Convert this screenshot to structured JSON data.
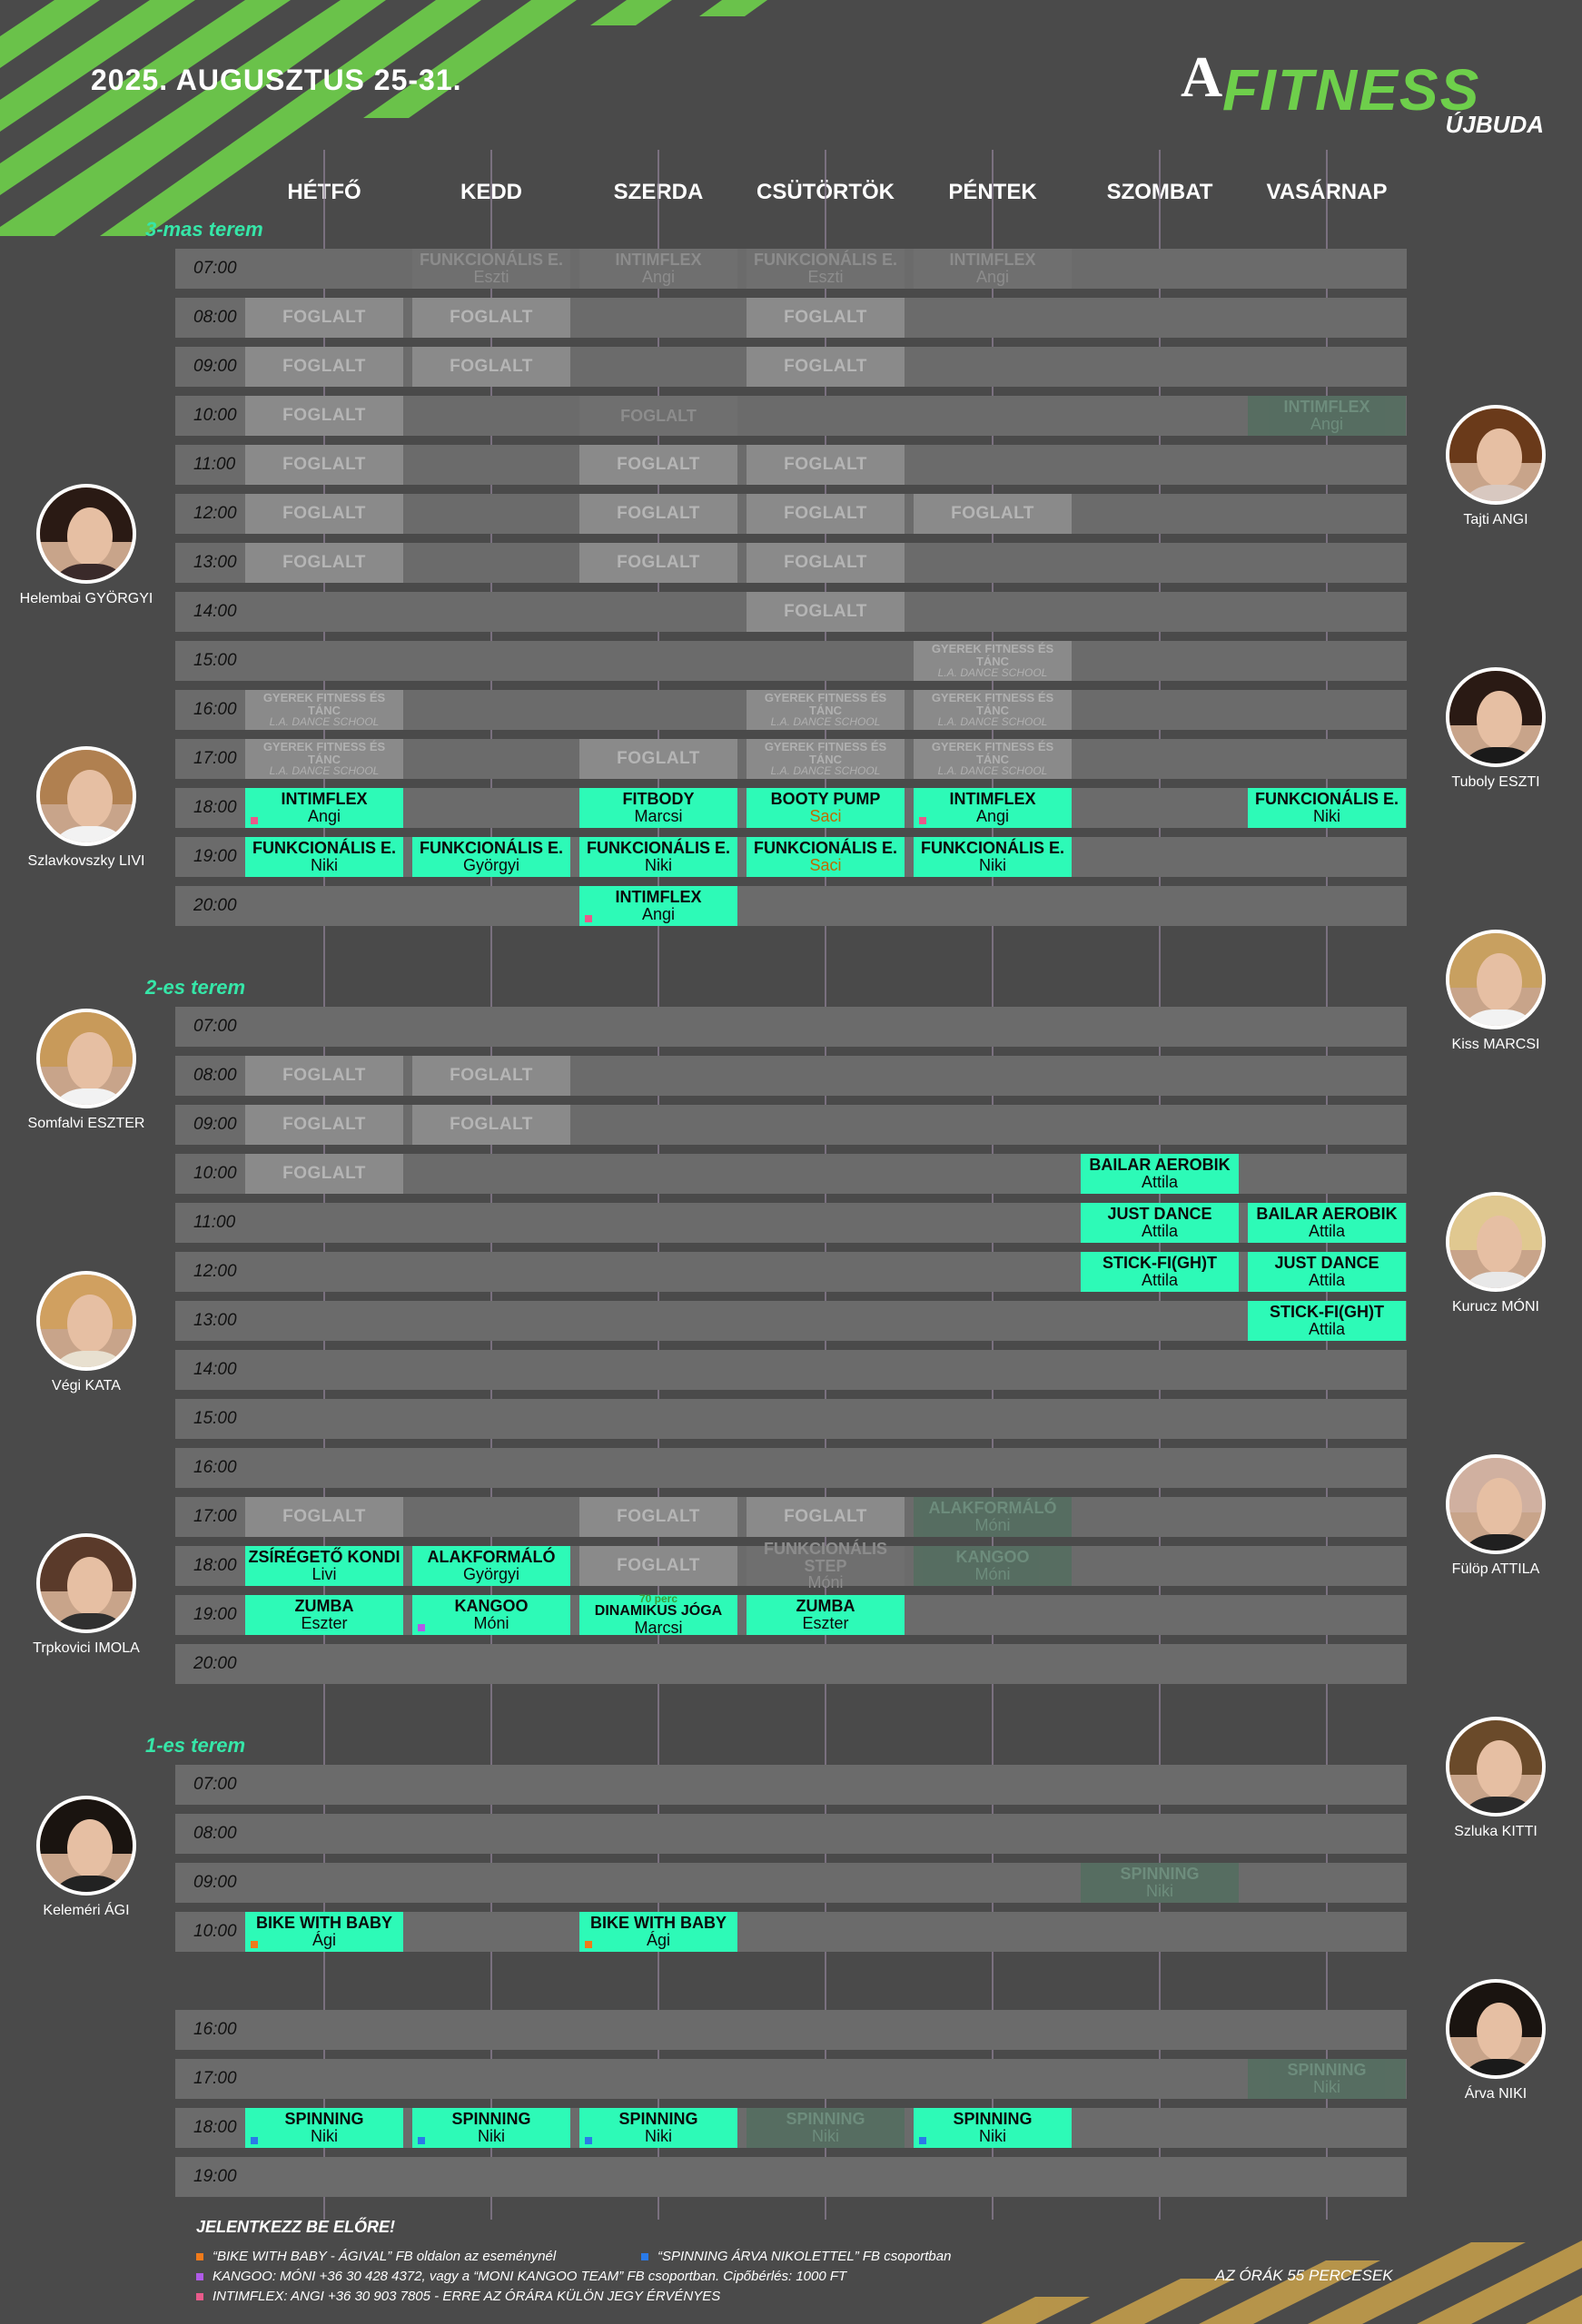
{
  "title": "2025. AUGUSZTUS 25-31.",
  "logo": {
    "mark": "A",
    "brand": "FITNESS",
    "location": "ÚJBUDA"
  },
  "days": [
    "HÉTFŐ",
    "KEDD",
    "SZERDA",
    "CSÜTÖRTÖK",
    "PÉNTEK",
    "SZOMBAT",
    "VASÁRNAP"
  ],
  "colors": {
    "active": "#2dfab7",
    "room_label": "#36e6a8",
    "stripe": "#6ecf4b",
    "background": "#4a4a4a"
  },
  "rooms": [
    {
      "label": "3-mas terem",
      "times": [
        "07:00",
        "08:00",
        "09:00",
        "10:00",
        "11:00",
        "12:00",
        "13:00",
        "14:00",
        "15:00",
        "16:00",
        "17:00",
        "18:00",
        "19:00",
        "20:00"
      ]
    },
    {
      "label": "2-es terem",
      "times": [
        "07:00",
        "08:00",
        "09:00",
        "10:00",
        "11:00",
        "12:00",
        "13:00",
        "14:00",
        "15:00",
        "16:00",
        "17:00",
        "18:00",
        "19:00",
        "20:00"
      ]
    },
    {
      "label": "1-es terem",
      "times": [
        "07:00",
        "08:00",
        "09:00",
        "10:00",
        "16:00",
        "17:00",
        "18:00",
        "19:00"
      ]
    }
  ],
  "classes": [
    {
      "room": 0,
      "slot": 0,
      "day": 1,
      "type": "faded",
      "title": "FUNKCIONÁLIS E.",
      "sub": "Eszti"
    },
    {
      "room": 0,
      "slot": 0,
      "day": 2,
      "type": "faded",
      "title": "INTIMFLEX",
      "sub": "Angi"
    },
    {
      "room": 0,
      "slot": 0,
      "day": 3,
      "type": "faded",
      "title": "FUNKCIONÁLIS E.",
      "sub": "Eszti"
    },
    {
      "room": 0,
      "slot": 0,
      "day": 4,
      "type": "faded",
      "title": "INTIMFLEX",
      "sub": "Angi"
    },
    {
      "room": 0,
      "slot": 1,
      "day": 0,
      "type": "busy",
      "title": "FOGLALT",
      "sub": ""
    },
    {
      "room": 0,
      "slot": 1,
      "day": 1,
      "type": "busy",
      "title": "FOGLALT",
      "sub": ""
    },
    {
      "room": 0,
      "slot": 1,
      "day": 3,
      "type": "busy",
      "title": "FOGLALT",
      "sub": ""
    },
    {
      "room": 0,
      "slot": 2,
      "day": 0,
      "type": "busy",
      "title": "FOGLALT",
      "sub": ""
    },
    {
      "room": 0,
      "slot": 2,
      "day": 1,
      "type": "busy",
      "title": "FOGLALT",
      "sub": ""
    },
    {
      "room": 0,
      "slot": 2,
      "day": 3,
      "type": "busy",
      "title": "FOGLALT",
      "sub": ""
    },
    {
      "room": 0,
      "slot": 3,
      "day": 0,
      "type": "busy",
      "title": "FOGLALT",
      "sub": ""
    },
    {
      "room": 0,
      "slot": 3,
      "day": 2,
      "type": "faded",
      "title": "FOGLALT",
      "sub": ""
    },
    {
      "room": 0,
      "slot": 3,
      "day": 6,
      "type": "ghost",
      "title": "INTIMFLEX",
      "sub": "Angi"
    },
    {
      "room": 0,
      "slot": 4,
      "day": 0,
      "type": "busy",
      "title": "FOGLALT",
      "sub": ""
    },
    {
      "room": 0,
      "slot": 4,
      "day": 2,
      "type": "busy",
      "title": "FOGLALT",
      "sub": ""
    },
    {
      "room": 0,
      "slot": 4,
      "day": 3,
      "type": "busy",
      "title": "FOGLALT",
      "sub": ""
    },
    {
      "room": 0,
      "slot": 5,
      "day": 0,
      "type": "busy",
      "title": "FOGLALT",
      "sub": ""
    },
    {
      "room": 0,
      "slot": 5,
      "day": 2,
      "type": "busy",
      "title": "FOGLALT",
      "sub": ""
    },
    {
      "room": 0,
      "slot": 5,
      "day": 3,
      "type": "busy",
      "title": "FOGLALT",
      "sub": ""
    },
    {
      "room": 0,
      "slot": 5,
      "day": 4,
      "type": "busy",
      "title": "FOGLALT",
      "sub": ""
    },
    {
      "room": 0,
      "slot": 6,
      "day": 0,
      "type": "busy",
      "title": "FOGLALT",
      "sub": ""
    },
    {
      "room": 0,
      "slot": 6,
      "day": 2,
      "type": "busy",
      "title": "FOGLALT",
      "sub": ""
    },
    {
      "room": 0,
      "slot": 6,
      "day": 3,
      "type": "busy",
      "title": "FOGLALT",
      "sub": ""
    },
    {
      "room": 0,
      "slot": 7,
      "day": 3,
      "type": "busy",
      "title": "FOGLALT",
      "sub": ""
    },
    {
      "room": 0,
      "slot": 8,
      "day": 4,
      "type": "kid",
      "title": "GYEREK FITNESS ÉS TÁNC",
      "sub": "L.A. DANCE SCHOOL"
    },
    {
      "room": 0,
      "slot": 9,
      "day": 0,
      "type": "kid",
      "title": "GYEREK FITNESS ÉS TÁNC",
      "sub": "L.A. DANCE SCHOOL"
    },
    {
      "room": 0,
      "slot": 9,
      "day": 3,
      "type": "kid",
      "title": "GYEREK FITNESS ÉS TÁNC",
      "sub": "L.A. DANCE SCHOOL"
    },
    {
      "room": 0,
      "slot": 9,
      "day": 4,
      "type": "kid",
      "title": "GYEREK FITNESS ÉS TÁNC",
      "sub": "L.A. DANCE SCHOOL"
    },
    {
      "room": 0,
      "slot": 10,
      "day": 0,
      "type": "kid",
      "title": "GYEREK FITNESS ÉS TÁNC",
      "sub": "L.A. DANCE SCHOOL"
    },
    {
      "room": 0,
      "slot": 10,
      "day": 2,
      "type": "busy",
      "title": "FOGLALT",
      "sub": ""
    },
    {
      "room": 0,
      "slot": 10,
      "day": 3,
      "type": "kid",
      "title": "GYEREK FITNESS ÉS TÁNC",
      "sub": "L.A. DANCE SCHOOL"
    },
    {
      "room": 0,
      "slot": 10,
      "day": 4,
      "type": "kid",
      "title": "GYEREK FITNESS ÉS TÁNC",
      "sub": "L.A. DANCE SCHOOL"
    },
    {
      "room": 0,
      "slot": 11,
      "day": 0,
      "type": "active",
      "title": "INTIMFLEX",
      "sub": "Angi",
      "dot": "#e85a8a"
    },
    {
      "room": 0,
      "slot": 11,
      "day": 2,
      "type": "active",
      "title": "FITBODY",
      "sub": "Marcsi"
    },
    {
      "room": 0,
      "slot": 11,
      "day": 3,
      "type": "active",
      "title": "BOOTY PUMP",
      "sub": "Saci",
      "subColor": "orange"
    },
    {
      "room": 0,
      "slot": 11,
      "day": 4,
      "type": "active",
      "title": "INTIMFLEX",
      "sub": "Angi",
      "dot": "#e85a8a"
    },
    {
      "room": 0,
      "slot": 11,
      "day": 6,
      "type": "active",
      "title": "FUNKCIONÁLIS E.",
      "sub": "Niki"
    },
    {
      "room": 0,
      "slot": 12,
      "day": 0,
      "type": "active",
      "title": "FUNKCIONÁLIS E.",
      "sub": "Niki"
    },
    {
      "room": 0,
      "slot": 12,
      "day": 1,
      "type": "active",
      "title": "FUNKCIONÁLIS E.",
      "sub": "Györgyi"
    },
    {
      "room": 0,
      "slot": 12,
      "day": 2,
      "type": "active",
      "title": "FUNKCIONÁLIS E.",
      "sub": "Niki"
    },
    {
      "room": 0,
      "slot": 12,
      "day": 3,
      "type": "active",
      "title": "FUNKCIONÁLIS E.",
      "sub": "Saci",
      "subColor": "orange"
    },
    {
      "room": 0,
      "slot": 12,
      "day": 4,
      "type": "active",
      "title": "FUNKCIONÁLIS E.",
      "sub": "Niki"
    },
    {
      "room": 0,
      "slot": 13,
      "day": 2,
      "type": "active",
      "title": "INTIMFLEX",
      "sub": "Angi",
      "dot": "#e85a8a"
    },
    {
      "room": 1,
      "slot": 1,
      "day": 0,
      "type": "busy",
      "title": "FOGLALT",
      "sub": ""
    },
    {
      "room": 1,
      "slot": 1,
      "day": 1,
      "type": "busy",
      "title": "FOGLALT",
      "sub": ""
    },
    {
      "room": 1,
      "slot": 2,
      "day": 0,
      "type": "busy",
      "title": "FOGLALT",
      "sub": ""
    },
    {
      "room": 1,
      "slot": 2,
      "day": 1,
      "type": "busy",
      "title": "FOGLALT",
      "sub": ""
    },
    {
      "room": 1,
      "slot": 3,
      "day": 0,
      "type": "busy",
      "title": "FOGLALT",
      "sub": ""
    },
    {
      "room": 1,
      "slot": 3,
      "day": 5,
      "type": "active",
      "title": "BAILAR AEROBIK",
      "sub": "Attila"
    },
    {
      "room": 1,
      "slot": 4,
      "day": 5,
      "type": "active",
      "title": "JUST DANCE",
      "sub": "Attila"
    },
    {
      "room": 1,
      "slot": 4,
      "day": 6,
      "type": "active",
      "title": "BAILAR AEROBIK",
      "sub": "Attila"
    },
    {
      "room": 1,
      "slot": 5,
      "day": 5,
      "type": "active",
      "title": "STICK-FI(GH)T",
      "sub": "Attila"
    },
    {
      "room": 1,
      "slot": 5,
      "day": 6,
      "type": "active",
      "title": "JUST DANCE",
      "sub": "Attila"
    },
    {
      "room": 1,
      "slot": 6,
      "day": 6,
      "type": "active",
      "title": "STICK-FI(GH)T",
      "sub": "Attila"
    },
    {
      "room": 1,
      "slot": 10,
      "day": 0,
      "type": "busy",
      "title": "FOGLALT",
      "sub": ""
    },
    {
      "room": 1,
      "slot": 10,
      "day": 2,
      "type": "busy",
      "title": "FOGLALT",
      "sub": ""
    },
    {
      "room": 1,
      "slot": 10,
      "day": 3,
      "type": "busy",
      "title": "FOGLALT",
      "sub": ""
    },
    {
      "room": 1,
      "slot": 10,
      "day": 4,
      "type": "ghost",
      "title": "ALAKFORMÁLÓ",
      "sub": "Móni"
    },
    {
      "room": 1,
      "slot": 11,
      "day": 0,
      "type": "active",
      "title": "ZSÍRÉGETŐ KONDI",
      "sub": "Livi"
    },
    {
      "room": 1,
      "slot": 11,
      "day": 1,
      "type": "active",
      "title": "ALAKFORMÁLÓ",
      "sub": "Györgyi"
    },
    {
      "room": 1,
      "slot": 11,
      "day": 2,
      "type": "busy",
      "title": "FOGLALT",
      "sub": ""
    },
    {
      "room": 1,
      "slot": 11,
      "day": 3,
      "type": "faded",
      "title": "FUNKCIONÁLIS STEP",
      "sub": "Móni"
    },
    {
      "room": 1,
      "slot": 11,
      "day": 4,
      "type": "ghost",
      "title": "KANGOO",
      "sub": "Móni"
    },
    {
      "room": 1,
      "slot": 12,
      "day": 0,
      "type": "active",
      "title": "ZUMBA",
      "sub": "Eszter"
    },
    {
      "room": 1,
      "slot": 12,
      "day": 1,
      "type": "active",
      "title": "KANGOO",
      "sub": "Móni",
      "dot": "#b05ae8"
    },
    {
      "room": 1,
      "slot": 12,
      "day": 2,
      "type": "active",
      "pre": "70 perc",
      "title": "DINAMIKUS JÓGA",
      "sub": "Marcsi"
    },
    {
      "room": 1,
      "slot": 12,
      "day": 3,
      "type": "active",
      "title": "ZUMBA",
      "sub": "Eszter"
    },
    {
      "room": 2,
      "slot": 2,
      "day": 5,
      "type": "ghost",
      "title": "SPINNING",
      "sub": "Niki"
    },
    {
      "room": 2,
      "slot": 3,
      "day": 0,
      "type": "active",
      "title": "BIKE WITH BABY",
      "sub": "Ági",
      "dot": "#f07a1a"
    },
    {
      "room": 2,
      "slot": 3,
      "day": 2,
      "type": "active",
      "title": "BIKE WITH BABY",
      "sub": "Ági",
      "dot": "#f07a1a"
    },
    {
      "room": 2,
      "slot": 5,
      "day": 6,
      "type": "ghost",
      "title": "SPINNING",
      "sub": "Niki"
    },
    {
      "room": 2,
      "slot": 6,
      "day": 0,
      "type": "active",
      "title": "SPINNING",
      "sub": "Niki",
      "dot": "#2a7ae8"
    },
    {
      "room": 2,
      "slot": 6,
      "day": 1,
      "type": "active",
      "title": "SPINNING",
      "sub": "Niki",
      "dot": "#2a7ae8"
    },
    {
      "room": 2,
      "slot": 6,
      "day": 2,
      "type": "active",
      "title": "SPINNING",
      "sub": "Niki",
      "dot": "#2a7ae8"
    },
    {
      "room": 2,
      "slot": 6,
      "day": 3,
      "type": "ghost",
      "title": "SPINNING",
      "sub": "Niki"
    },
    {
      "room": 2,
      "slot": 6,
      "day": 4,
      "type": "active",
      "title": "SPINNING",
      "sub": "Niki",
      "dot": "#2a7ae8"
    }
  ],
  "trainers_left": [
    {
      "name": "Helembai GYÖRGYI",
      "hair": "#2a1a14",
      "shirt": "#3a2a2a"
    },
    {
      "name": "Szlavkovszky LIVI",
      "hair": "#b08050",
      "shirt": "#f2f2f2"
    },
    {
      "name": "Somfalvi ESZTER",
      "hair": "#c89a5a",
      "shirt": "#f2f2f2"
    },
    {
      "name": "Végi KATA",
      "hair": "#d0a060",
      "shirt": "#e8e0d0"
    },
    {
      "name": "Trpkovici IMOLA",
      "hair": "#5a3a2a",
      "shirt": "#303030"
    },
    {
      "name": "Keleméri ÁGI",
      "hair": "#1a1410",
      "shirt": "#222222"
    }
  ],
  "trainers_right": [
    {
      "name": "Tajti ANGI",
      "hair": "#6a3a1a",
      "shirt": "#d8c8c0"
    },
    {
      "name": "Tuboly ESZTI",
      "hair": "#2a1a14",
      "shirt": "#1a1a1a"
    },
    {
      "name": "Kiss MARCSI",
      "hair": "#c8a060",
      "shirt": "#f2f2f2"
    },
    {
      "name": "Kurucz MÓNI",
      "hair": "#e0c890",
      "shirt": "#e8e8e8"
    },
    {
      "name": "Fülöp ATTILA",
      "hair": "#d0b0a0",
      "shirt": "#202020"
    },
    {
      "name": "Szluka KITTI",
      "hair": "#6a4a2a",
      "shirt": "#2a2a2a"
    },
    {
      "name": "Árva NIKI",
      "hair": "#1a1410",
      "shirt": "#1a1a1a"
    }
  ],
  "footer": {
    "heading": "JELENTKEZZ BE ELŐRE!",
    "notes": [
      {
        "text": "“BIKE WITH BABY - ÁGIVAL” FB oldalon az eseménynél",
        "color": "#f07a1a"
      },
      {
        "text": "KANGOO: MÓNI +36 30 428 4372, vagy a “MONI KANGOO TEAM” FB csoportban. Cipőbérlés: 1000 FT",
        "color": "#b05ae8"
      },
      {
        "text": "INTIMFLEX: ANGI +36 30 903 7805 - ERRE AZ ÓRÁRA KÜLÖN JEGY ÉRVÉNYES",
        "color": "#e85a8a"
      }
    ],
    "note_spinning": {
      "text": "“SPINNING ÁRVA NIKOLETTEL” FB csoportban",
      "color": "#2a7ae8"
    },
    "duration": "AZ ÓRÁK 55 PERCESEK"
  }
}
